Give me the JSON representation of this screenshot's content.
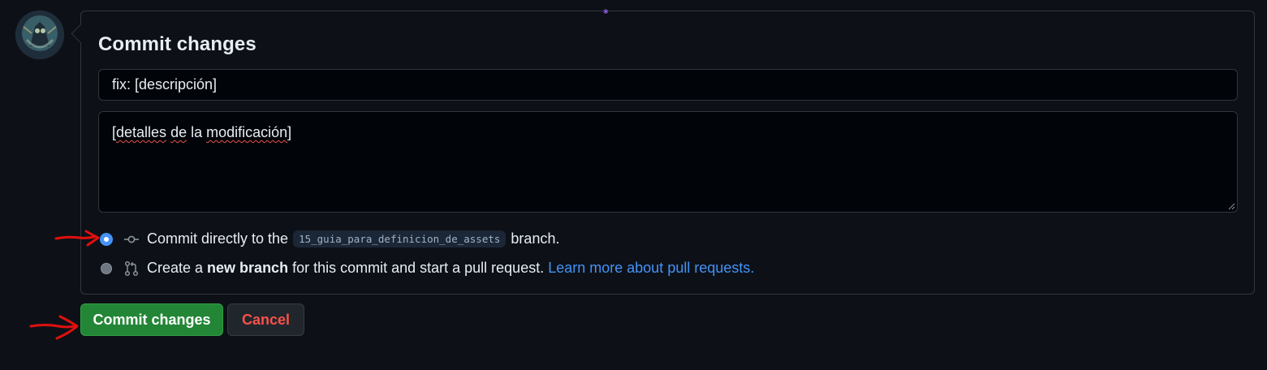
{
  "form": {
    "heading": "Commit changes",
    "summary_value": "fix: [descripción]",
    "description": {
      "prefix": "[",
      "word1": "detalles",
      "space1": " ",
      "word2": "de",
      "word3": " la ",
      "word4": "modificación",
      "suffix": "]"
    },
    "options": {
      "direct": {
        "selected": true,
        "prefix": "Commit directly to the",
        "branch": "15_guia_para_definicion_de_assets",
        "suffix": "branch."
      },
      "new_branch": {
        "selected": false,
        "prefix": "Create a",
        "bold": "new branch",
        "suffix": "for this commit and start a pull request.",
        "link": "Learn more about pull requests."
      }
    }
  },
  "buttons": {
    "commit_label": "Commit changes",
    "cancel_label": "Cancel"
  },
  "icons": {
    "commit": "git-commit-icon",
    "pull_request": "git-pull-request-icon",
    "avatar": "user-avatar"
  },
  "colors": {
    "background": "#0d1117",
    "accent_green": "#238636",
    "link_blue": "#4493f8",
    "cancel_red": "#f85149",
    "annotation_red": "#e0100e"
  }
}
